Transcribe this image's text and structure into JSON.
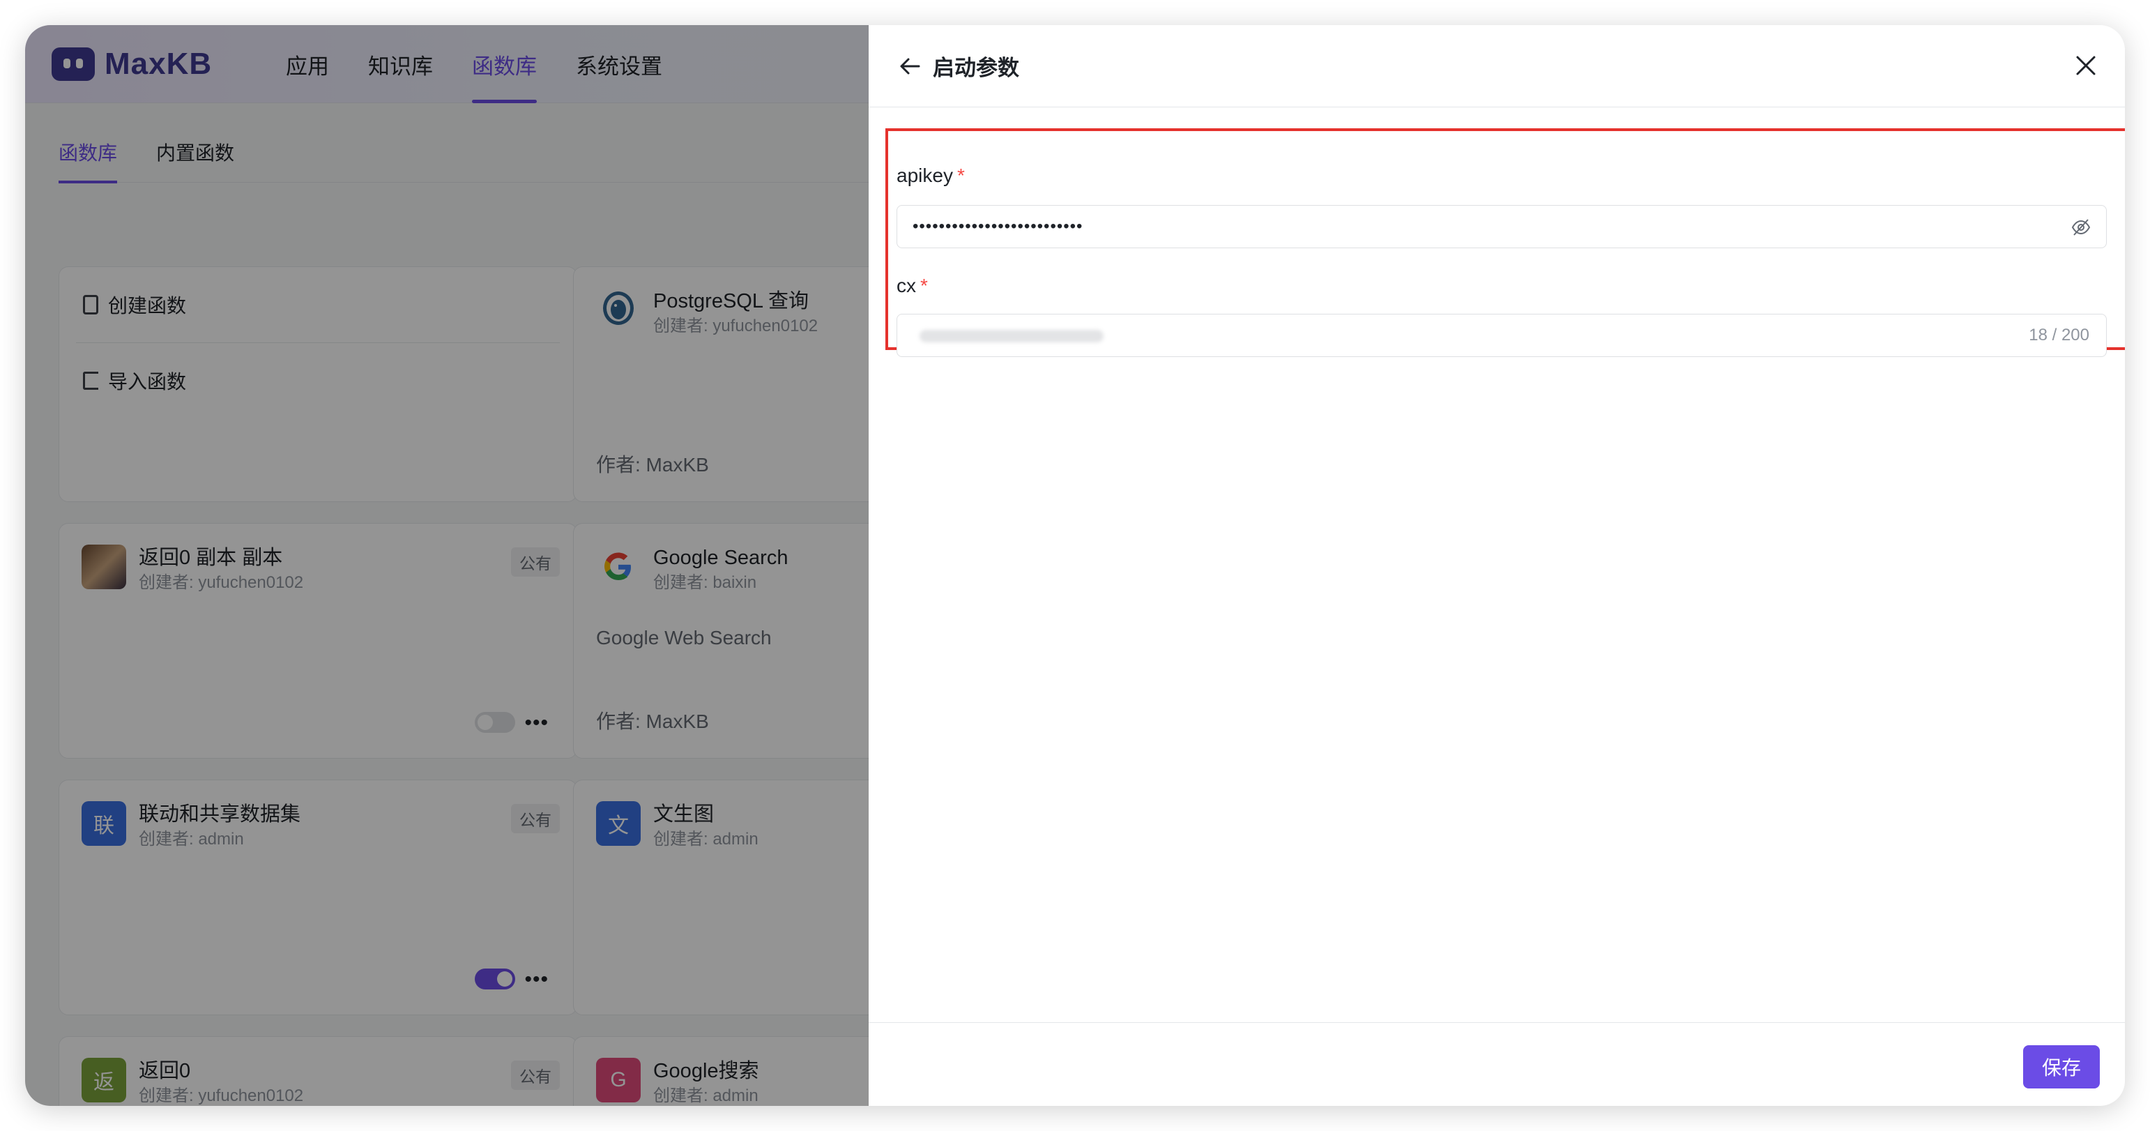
{
  "app": {
    "logo_text": "MaxKB",
    "nav": [
      {
        "label": "应用"
      },
      {
        "label": "知识库"
      },
      {
        "label": "函数库"
      },
      {
        "label": "系统设置"
      }
    ],
    "subtabs": [
      {
        "label": "函数库"
      },
      {
        "label": "内置函数"
      }
    ],
    "create_actions": [
      {
        "label": "创建函数",
        "icon": "new-doc-icon"
      },
      {
        "label": "导入函数",
        "icon": "import-icon"
      }
    ],
    "cards": [
      {
        "title": "PostgreSQL 查询",
        "creator": "创建者: yufuchen0102",
        "author": "作者: MaxKB",
        "icon": "postgresql-icon"
      },
      {
        "title": "返回0 副本 副本",
        "creator": "创建者: yufuchen0102",
        "badge": "公有",
        "toggle_on": false,
        "icon": "user-photo-avatar"
      },
      {
        "title": "Google Search",
        "creator": "创建者: baixin",
        "desc": "Google Web Search",
        "author": "作者: MaxKB",
        "icon": "google-icon"
      },
      {
        "title": "联动和共享数据集",
        "creator": "创建者: admin",
        "badge": "公有",
        "toggle_on": true,
        "avatar_char": "联",
        "avatar_color": "#3a6fe0"
      },
      {
        "title": "文生图",
        "creator": "创建者: admin",
        "avatar_char": "文",
        "avatar_color": "#3a6fe0"
      },
      {
        "title": "返回0",
        "creator": "创建者: yufuchen0102",
        "badge": "公有",
        "avatar_char": "返",
        "avatar_color": "#7ba33c"
      },
      {
        "title": "Google搜索",
        "creator": "创建者: admin",
        "avatar_char": "G",
        "avatar_color": "#e14a7a"
      }
    ],
    "more_label": "•••"
  },
  "drawer": {
    "title": "启动参数",
    "fields": [
      {
        "label": "apikey",
        "required_mark": "*",
        "value": "••••••••••••••••••••••••••",
        "type": "password"
      },
      {
        "label": "cx",
        "required_mark": "*",
        "count": "18 / 200",
        "type": "text"
      }
    ],
    "save_label": "保存"
  },
  "colors": {
    "accent": "#6b4ce6",
    "highlight": "#e5322d",
    "required": "#f54a45"
  }
}
